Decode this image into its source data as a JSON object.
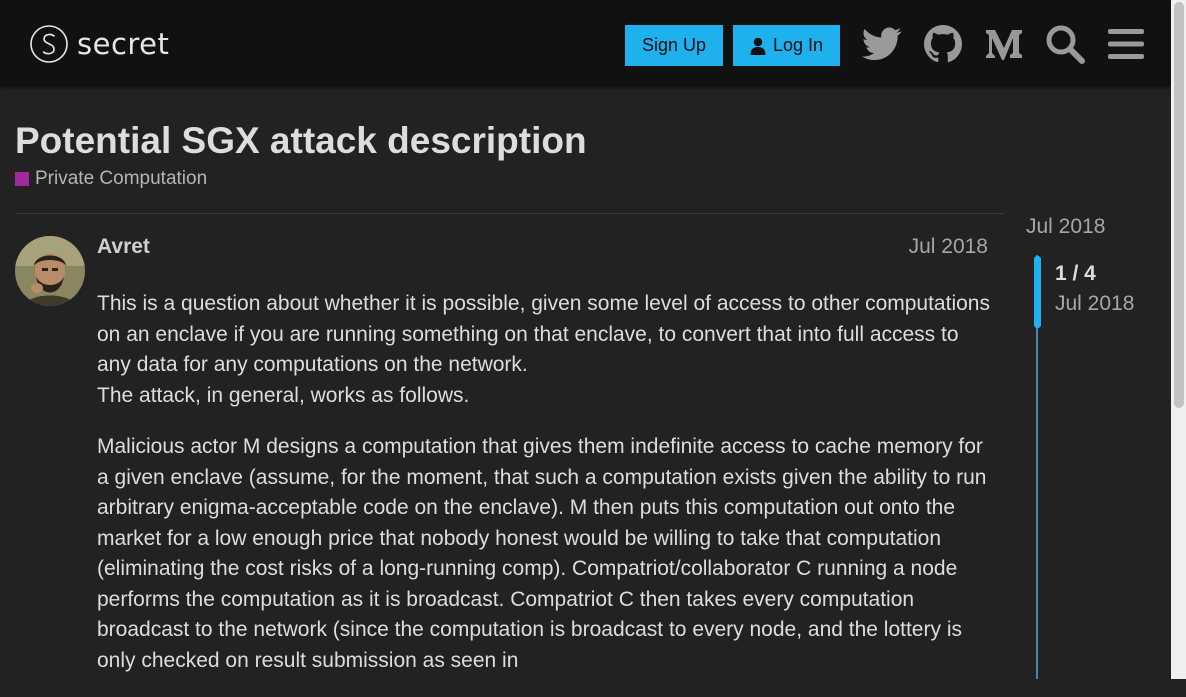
{
  "header": {
    "logo_text": "secret",
    "signup_label": "Sign Up",
    "login_label": "Log In",
    "icons": [
      "twitter-icon",
      "github-icon",
      "medium-icon",
      "search-icon",
      "hamburger-menu-icon"
    ]
  },
  "topic": {
    "title": "Potential SGX attack description",
    "category": "Private Computation",
    "category_color": "#9e2a9b"
  },
  "post": {
    "username": "Avret",
    "date": "Jul 2018",
    "paragraphs": [
      "This is a question about whether it is possible, given some level of access to other computations on an enclave if you are running something on that enclave, to convert that into full access to any data for any computations on the network.",
      "The attack, in general, works as follows.",
      "Malicious actor M designs a computation that gives them indefinite access to cache memory for a given enclave (assume, for the moment, that such a computation exists given the ability to run arbitrary enigma-acceptable code on the enclave). M then puts this computation out onto the market for a low enough price that nobody honest would be willing to take that computation (eliminating the cost risks of a long-running comp). Compatriot/collaborator C running a node performs the computation as it is broadcast. Compatriot C then takes every computation broadcast to the network (since the computation is broadcast to every node, and the lottery is only checked on result submission as seen in"
    ]
  },
  "timeline": {
    "start_date": "Jul 2018",
    "position": "1 / 4",
    "current_date": "Jul 2018"
  },
  "colors": {
    "accent": "#1fb0ee",
    "background": "#222222",
    "header": "#111111"
  }
}
